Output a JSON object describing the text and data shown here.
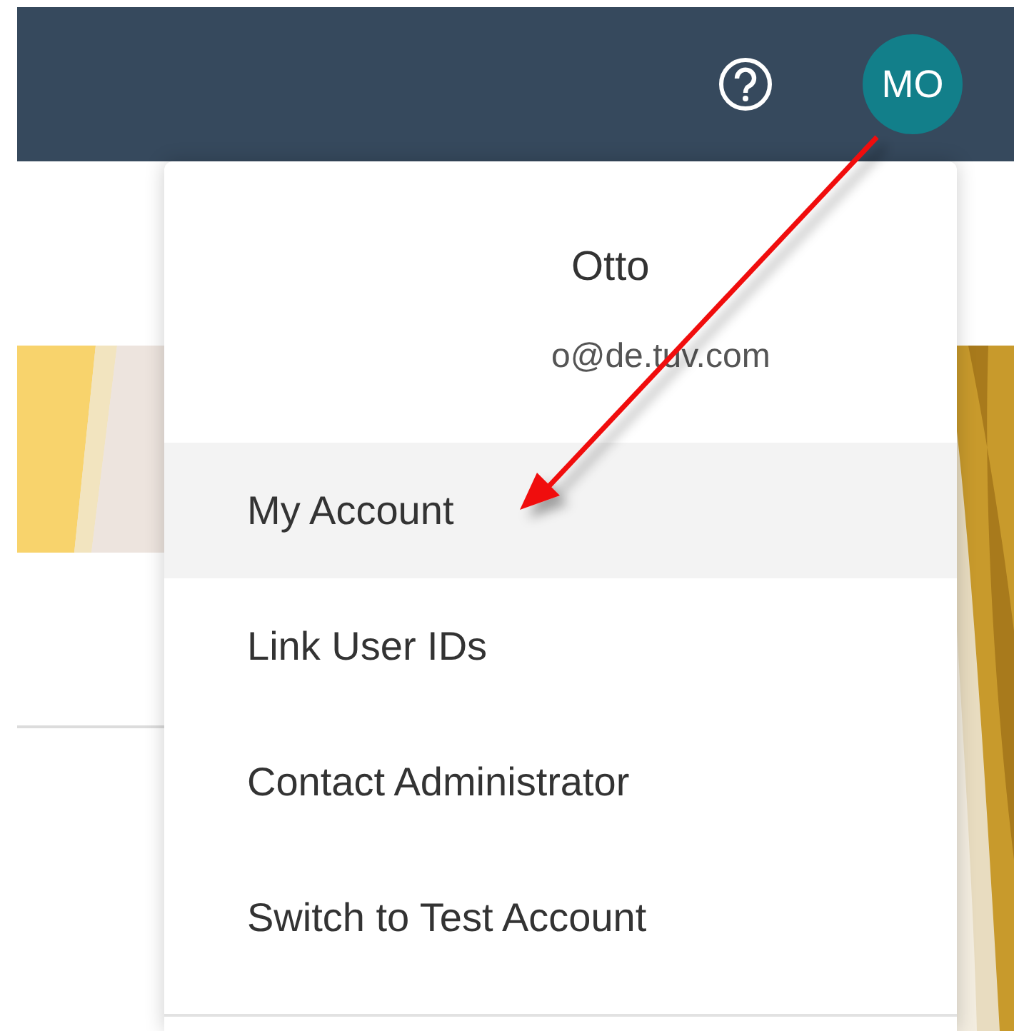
{
  "top_bar": {
    "avatar": {
      "initials": "MO"
    }
  },
  "user_menu": {
    "name": "Otto",
    "email": "o@de.tuv.com",
    "items": [
      {
        "label": "My Account",
        "selected": true
      },
      {
        "label": "Link User IDs",
        "selected": false
      },
      {
        "label": "Contact Administrator",
        "selected": false
      },
      {
        "label": "Switch to Test Account",
        "selected": false
      }
    ]
  }
}
